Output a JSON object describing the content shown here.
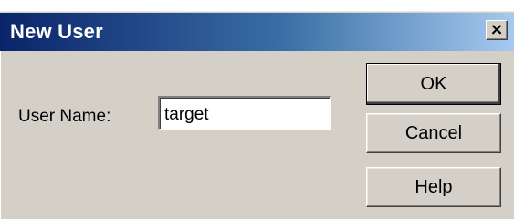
{
  "window": {
    "title": "New User",
    "close_glyph": "×"
  },
  "form": {
    "user_name_label": "User Name:",
    "user_name_value": "target"
  },
  "buttons": {
    "ok_label": "OK",
    "cancel_label": "Cancel",
    "help_label": "Help"
  },
  "colors": {
    "titlebar_start": "#0a246a",
    "titlebar_end": "#a6caf0",
    "dialog_face": "#d4d0c8"
  }
}
